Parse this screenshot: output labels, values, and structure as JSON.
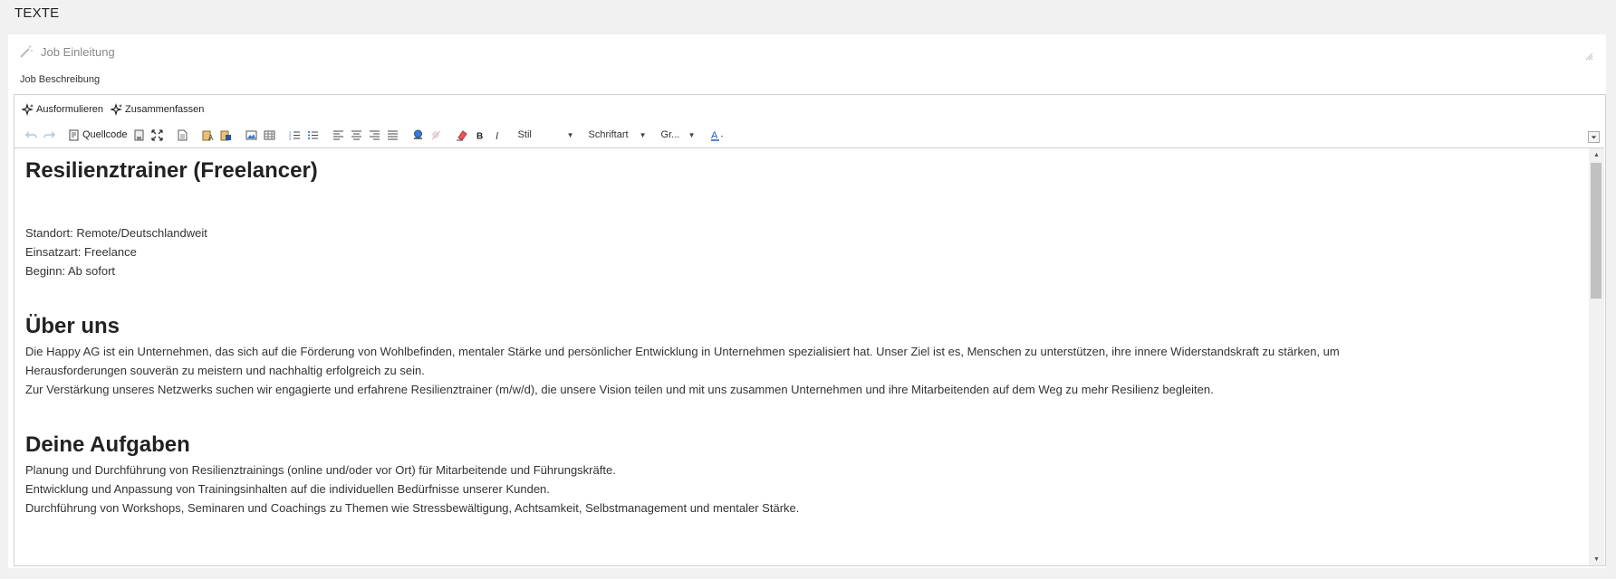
{
  "section": {
    "title": "TEXTE"
  },
  "panel": {
    "intro_label": "Job Einleitung",
    "field_label": "Job Beschreibung"
  },
  "ai": {
    "formulate": "Ausformulieren",
    "summarize": "Zusammenfassen"
  },
  "toolbar": {
    "source_label": "Quellcode",
    "style": "Stil",
    "font": "Schriftart",
    "size": "Gr..."
  },
  "doc": {
    "title": "Resilienztrainer (Freelancer)",
    "meta": [
      "Standort: Remote/Deutschlandweit",
      "Einsatzart: Freelance",
      "Beginn: Ab sofort"
    ],
    "about_heading": "Über uns",
    "about_lines": [
      "Die Happy AG ist ein Unternehmen, das sich auf die Förderung von Wohlbefinden, mentaler Stärke und persönlicher Entwicklung in Unternehmen spezialisiert hat. Unser Ziel ist es, Menschen zu unterstützen, ihre innere Widerstandskraft zu stärken, um",
      "Herausforderungen souverän zu meistern und nachhaltig erfolgreich zu sein.",
      "Zur Verstärkung unseres Netzwerks suchen wir engagierte und erfahrene Resilienztrainer (m/w/d), die unsere Vision teilen und mit uns zusammen Unternehmen und ihre Mitarbeitenden auf dem Weg zu mehr Resilienz begleiten."
    ],
    "tasks_heading": "Deine Aufgaben",
    "tasks": [
      "Planung und Durchführung von Resilienztrainings (online und/oder vor Ort) für Mitarbeitende und Führungskräfte.",
      "Entwicklung und Anpassung von Trainingsinhalten auf die individuellen Bedürfnisse unserer Kunden.",
      "Durchführung von Workshops, Seminaren und Coachings zu Themen wie Stressbewältigung, Achtsamkeit, Selbstmanagement und mentaler Stärke."
    ]
  },
  "colors": {
    "accent": "#1a5fb4",
    "text": "#333333",
    "border": "#d1d1d1"
  }
}
